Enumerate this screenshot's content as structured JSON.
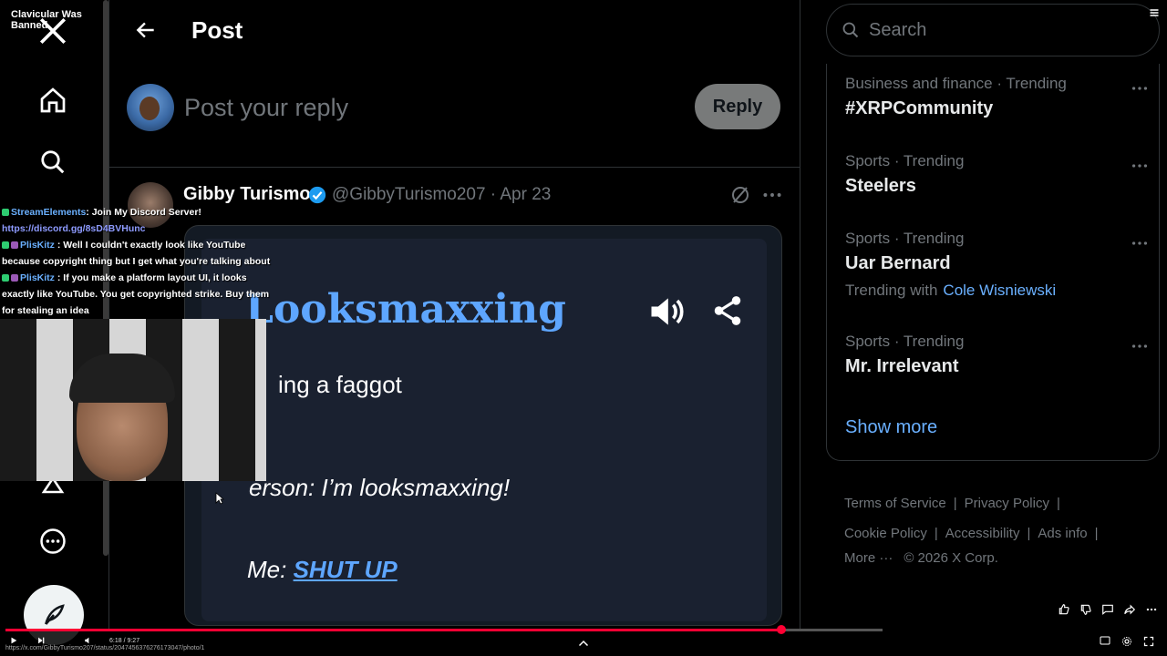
{
  "stream": {
    "title": "Clavicular Was Banned",
    "chat": [
      {
        "user": "StreamElements",
        "text": ": Join My Discord Server!"
      },
      {
        "link": "https://discord.gg/8sD4BVHunc"
      },
      {
        "user": "PlisKitz",
        "text": ": Well I couldn't exactly look like YouTube because copyright thing but I get what you're talking about"
      },
      {
        "user": "PlisKitz",
        "text": ": If you make a platform layout UI, it looks exactly like YouTube. You get copyrighted strike. Buy them for stealing an idea"
      }
    ]
  },
  "header": {
    "title": "Post"
  },
  "reply": {
    "placeholder": "Post your reply",
    "button_label": "Reply"
  },
  "tweet": {
    "name": "Gibby Turismo",
    "handle": "@GibbyTurismo207 · Apr 23",
    "media": {
      "title": "Looksmaxxing",
      "line1": "ing a faggot",
      "line2": "erson: I’m looksmaxxing!",
      "line3_prefix": "Me: ",
      "line3_link": "SHUT UP"
    }
  },
  "sidebar": {
    "search_placeholder": "Search",
    "trends": [
      {
        "category": "Business and finance · Trending",
        "name": "#XRPCommunity"
      },
      {
        "category": "Sports · Trending",
        "name": "Steelers"
      },
      {
        "category": "Sports · Trending",
        "name": "Uar Bernard",
        "with_label": "Trending with",
        "with_link": "Cole Wisniewski"
      },
      {
        "category": "Sports · Trending",
        "name": "Mr. Irrelevant"
      }
    ],
    "show_more": "Show more",
    "footer": {
      "terms": "Terms of Service",
      "privacy": "Privacy Policy",
      "cookie": "Cookie Policy",
      "accessibility": "Accessibility",
      "ads": "Ads info",
      "more": "More ···",
      "copyright": "© 2026 X Corp."
    }
  },
  "player": {
    "url": "https://x.com/GibbyTurismo207/status/2047456376276173047/photo/1",
    "time": "6:18 / 9:27",
    "progress": 0.885
  },
  "colors": {
    "accent": "#1d9bf0",
    "link": "#6ab0ff",
    "progress": "#ff0033"
  }
}
